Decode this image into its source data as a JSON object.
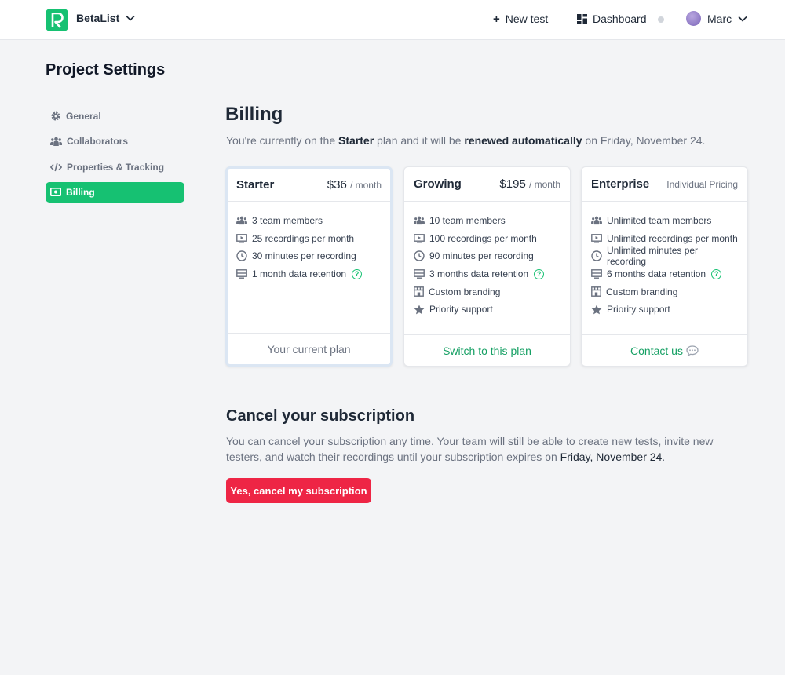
{
  "header": {
    "workspace": "BetaList",
    "logo_letter": "R",
    "new_test": "New test",
    "dashboard": "Dashboard",
    "user": "Marc"
  },
  "page_title": "Project Settings",
  "sidebar": {
    "items": [
      {
        "label": "General",
        "icon": "gear-icon"
      },
      {
        "label": "Collaborators",
        "icon": "users-icon"
      },
      {
        "label": "Properties & Tracking",
        "icon": "code-icon"
      },
      {
        "label": "Billing",
        "icon": "billing-icon",
        "active": true
      }
    ]
  },
  "billing": {
    "title": "Billing",
    "desc": {
      "prefix": "You're currently on the ",
      "plan": "Starter",
      "mid": " plan and it will be ",
      "renewal": "renewed automatically",
      "suffix": " on Friday, November 24."
    }
  },
  "plans": [
    {
      "name": "Starter",
      "price": "$36",
      "per": "/ month",
      "features": [
        "3 team members",
        "25 recordings per month",
        "30 minutes per recording",
        "1 month data retention"
      ],
      "footer": "Your current plan"
    },
    {
      "name": "Growing",
      "price": "$195",
      "per": "/ month",
      "features": [
        "10 team members",
        "100 recordings per month",
        "90 minutes per recording",
        "3 months data retention",
        "Custom branding",
        "Priority support"
      ],
      "footer": "Switch to this plan"
    },
    {
      "name": "Enterprise",
      "price_text": "Individual Pricing",
      "features": [
        "Unlimited team members",
        "Unlimited recordings per month",
        "Unlimited minutes per recording",
        "6 months data retention",
        "Custom branding",
        "Priority support"
      ],
      "footer": "Contact us"
    }
  ],
  "cancel": {
    "title": "Cancel your subscription",
    "desc_prefix": "You can cancel your subscription any time. Your team will still be able to create new tests, invite new testers, and watch their recordings until your subscription expires on ",
    "date": "Friday, November 24",
    "desc_suffix": ".",
    "button": "Yes, cancel my subscription"
  },
  "colors": {
    "brand": "#16c172",
    "danger": "#ee2545"
  }
}
